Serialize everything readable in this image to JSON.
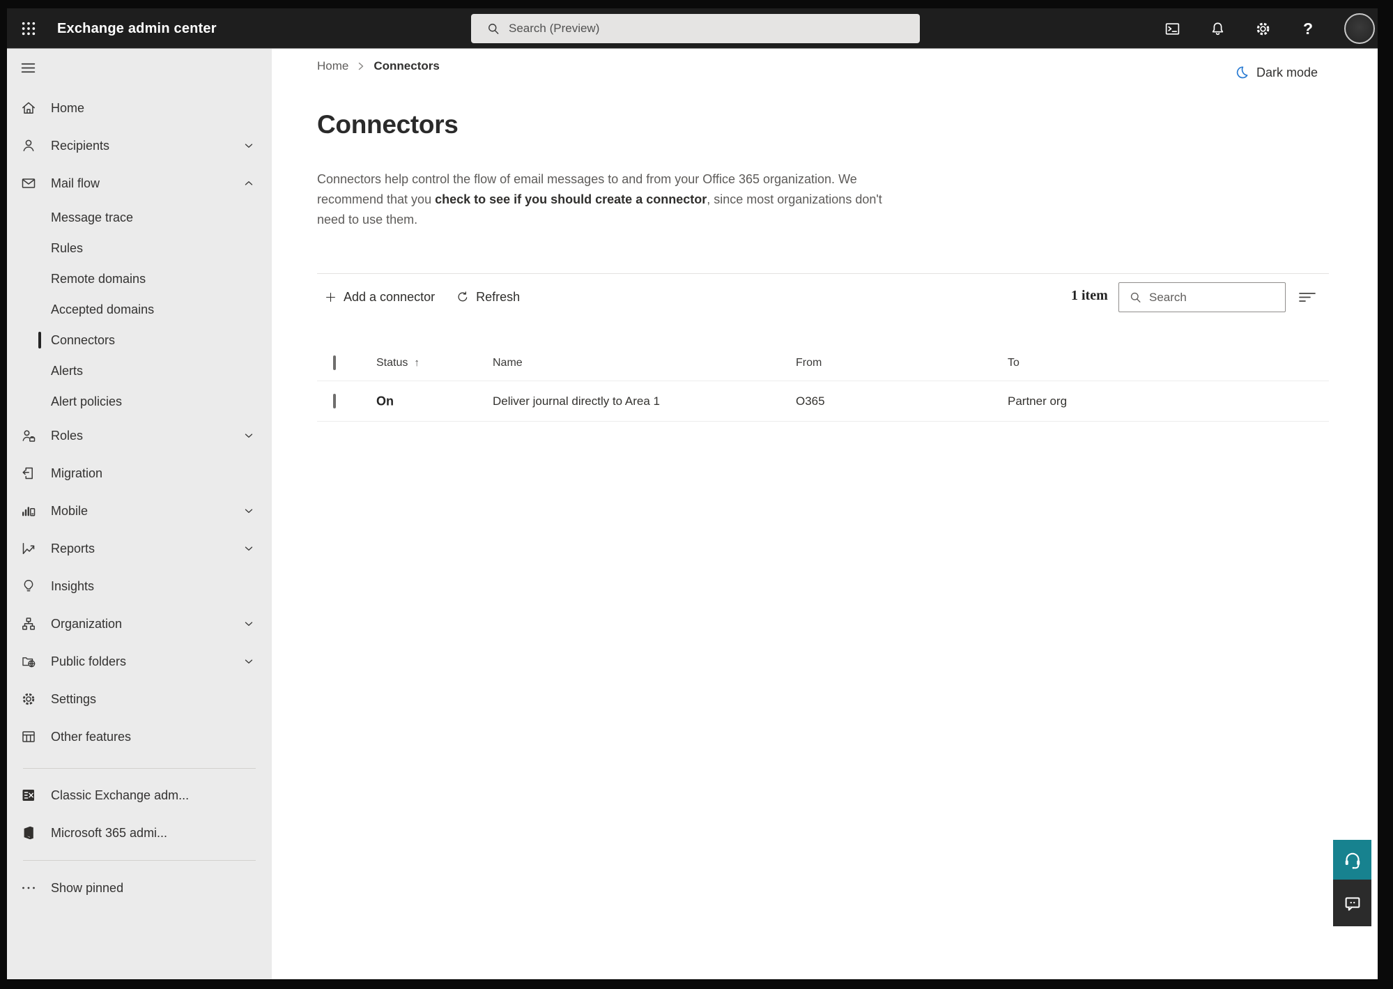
{
  "topbar": {
    "app_title": "Exchange admin center",
    "search_placeholder": "Search (Preview)",
    "icons": [
      "waffle-icon",
      "terminal-icon",
      "bell-icon",
      "gear-icon",
      "help-icon",
      "avatar"
    ]
  },
  "sidebar": {
    "items": [
      {
        "label": "Home",
        "icon": "home-icon"
      },
      {
        "label": "Recipients",
        "icon": "person-icon",
        "chevron": "down"
      },
      {
        "label": "Mail flow",
        "icon": "mail-icon",
        "chevron": "up",
        "expanded": true
      },
      {
        "label": "Message trace",
        "sub": true
      },
      {
        "label": "Rules",
        "sub": true
      },
      {
        "label": "Remote domains",
        "sub": true
      },
      {
        "label": "Accepted domains",
        "sub": true
      },
      {
        "label": "Connectors",
        "sub": true,
        "selected": true
      },
      {
        "label": "Alerts",
        "sub": true
      },
      {
        "label": "Alert policies",
        "sub": true
      },
      {
        "label": "Roles",
        "icon": "roles-icon",
        "chevron": "down"
      },
      {
        "label": "Migration",
        "icon": "migration-icon"
      },
      {
        "label": "Mobile",
        "icon": "mobile-icon",
        "chevron": "down"
      },
      {
        "label": "Reports",
        "icon": "reports-icon",
        "chevron": "down"
      },
      {
        "label": "Insights",
        "icon": "lightbulb-icon"
      },
      {
        "label": "Organization",
        "icon": "org-chart-icon",
        "chevron": "down"
      },
      {
        "label": "Public folders",
        "icon": "folder-globe-icon",
        "chevron": "down"
      },
      {
        "label": "Settings",
        "icon": "gear-icon"
      },
      {
        "label": "Other features",
        "icon": "table-icon"
      },
      {
        "label": "Classic Exchange adm...",
        "icon": "exchange-logo"
      },
      {
        "label": "Microsoft 365 admi...",
        "icon": "m365-logo"
      },
      {
        "label": "Show pinned",
        "icon": "ellipsis-icon"
      }
    ]
  },
  "breadcrumb": {
    "home": "Home",
    "current": "Connectors"
  },
  "header": {
    "dark_mode_label": "Dark mode"
  },
  "page": {
    "title": "Connectors",
    "description": {
      "line1": "Connectors help control the flow of email messages to and from your Office 365 organization. We",
      "line2_pre": "recommend that you ",
      "line2_strong": "check to see if you should create a connector",
      "line2_post": ", since most organizations don't",
      "line3": "need to use them."
    }
  },
  "toolbar": {
    "add_label": "Add a connector",
    "refresh_label": "Refresh",
    "item_count": "1 item",
    "search_placeholder": "Search"
  },
  "table": {
    "columns": {
      "status": "Status",
      "name": "Name",
      "from": "From",
      "to": "To"
    },
    "sort_column": "Status",
    "sort_direction": "ascending",
    "rows": [
      {
        "status": "On",
        "name": "Deliver journal directly to Area 1",
        "from": "O365",
        "to": "Partner org"
      }
    ]
  },
  "colors": {
    "topbar_bg": "#1e1e1e",
    "sidebar_bg": "#ebebeb",
    "accent_teal": "#17828f",
    "feedback_dark": "#2b2b2b",
    "dark_mode_icon_blue": "#2b7cd3"
  }
}
